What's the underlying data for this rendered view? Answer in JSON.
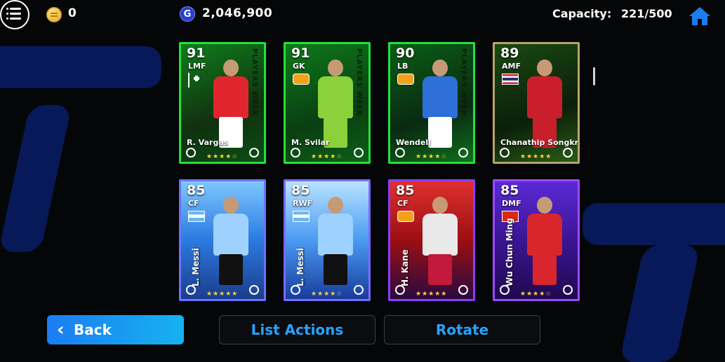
{
  "header": {
    "coins": "0",
    "gp": "2,046,900",
    "gp_icon_letter": "G",
    "capacity_label": "Capacity:",
    "capacity_value": "221/500"
  },
  "cards": [
    {
      "rating": "91",
      "position": "LMF",
      "name": "R. Vargas",
      "stars": 4,
      "style": "c1",
      "flag": "switzerland",
      "side_text": "PLAYERS WEEK"
    },
    {
      "rating": "91",
      "position": "GK",
      "name": "M. Svilar",
      "stars": 4,
      "style": "c2",
      "flag": "club",
      "side_text": "PLAYERS WEEK"
    },
    {
      "rating": "90",
      "position": "LB",
      "name": "Wendell",
      "stars": 4,
      "style": "c3",
      "flag": "club",
      "side_text": "PLAYERS WEEK"
    },
    {
      "rating": "89",
      "position": "AMF",
      "name": "Chanathip Songkrasin",
      "stars": 5,
      "style": "c4",
      "flag": "thailand",
      "side_text": ""
    },
    {
      "rating": "85",
      "position": "CF",
      "name": "L. Messi",
      "stars": 5,
      "style": "c5",
      "flag": "argentina",
      "side_text": ""
    },
    {
      "rating": "85",
      "position": "RWF",
      "name": "L. Messi",
      "stars": 4,
      "style": "c6",
      "flag": "argentina",
      "side_text": ""
    },
    {
      "rating": "85",
      "position": "CF",
      "name": "H. Kane",
      "stars": 5,
      "style": "c7",
      "flag": "club",
      "side_text": ""
    },
    {
      "rating": "85",
      "position": "DMF",
      "name": "Wu Chun Ming",
      "stars": 4,
      "style": "c8",
      "flag": "hongkong",
      "side_text": ""
    }
  ],
  "footer": {
    "back_label": "Back",
    "list_actions_label": "List Actions",
    "rotate_label": "Rotate"
  },
  "colors": {
    "accent": "#1b9cf2",
    "link": "#27a3ff",
    "home": "#1c7df1"
  }
}
